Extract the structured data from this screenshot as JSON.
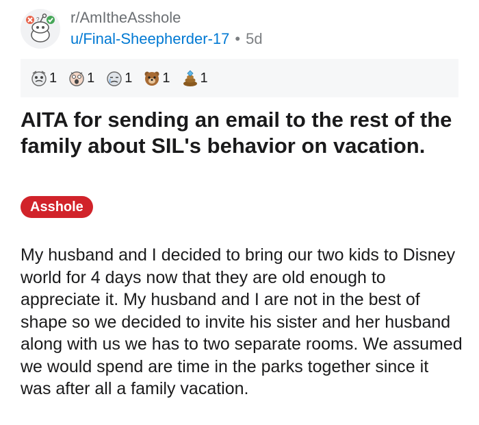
{
  "post": {
    "subreddit": "r/AmItheAsshole",
    "author": "u/Final-Sheepherder-17",
    "separator": "•",
    "age": "5d",
    "title": "AITA for sending an email to the rest of the family about SIL's behavior on vacation.",
    "flair": "Asshole",
    "flair_color": "#d1232a",
    "body": "My husband and I decided to bring our two kids to Disney world for 4 days now that they are old enough to appreciate it. My husband and I are not in the best of shape so we decided to invite his sister and her husband along with us we has to two separate rooms. We assumed we would spend are time in the parks together since it was after all a family vacation."
  },
  "awards": [
    {
      "icon": "face-award-icon",
      "count": "1"
    },
    {
      "icon": "shocked-face-award-icon",
      "count": "1"
    },
    {
      "icon": "crying-face-award-icon",
      "count": "1"
    },
    {
      "icon": "bear-award-icon",
      "count": "1"
    },
    {
      "icon": "gem-poop-award-icon",
      "count": "1"
    }
  ],
  "colors": {
    "link": "#0079d3",
    "muted": "#7c7f82",
    "awards_bg": "#f6f7f8"
  }
}
